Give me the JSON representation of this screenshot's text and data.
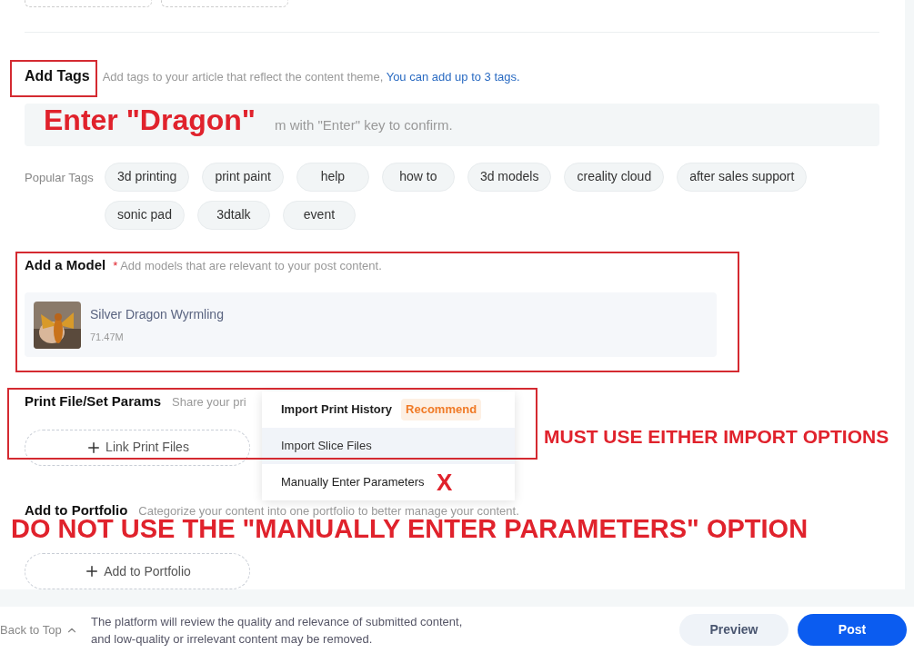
{
  "tags_section": {
    "title": "Add Tags",
    "hint": "Add tags to your article that reflect the content theme,",
    "limit_link": "You can add up to 3 tags.",
    "field": {
      "placeholder": "m with \"Enter\" key to confirm."
    },
    "popular_label": "Popular Tags",
    "popular_tags": [
      "3d printing",
      "print paint",
      "help",
      "how to",
      "3d models",
      "creality cloud",
      "after sales support",
      "sonic pad",
      "3dtalk",
      "event"
    ]
  },
  "model_section": {
    "title": "Add a Model",
    "required_mark": "*",
    "hint": "Add models that are relevant to your post content.",
    "models": [
      {
        "name": "Silver Dragon Wyrmling",
        "size": "71.47M"
      }
    ]
  },
  "print_section": {
    "title": "Print File/Set Params",
    "hint": "Share your pri",
    "button": "Link Print Files",
    "menu": [
      {
        "label": "Import Print History",
        "badge": "Recommend",
        "selected": false
      },
      {
        "label": "Import Slice Files",
        "selected": true
      },
      {
        "label": "Manually Enter Parameters",
        "selected": false
      }
    ]
  },
  "portfolio_section": {
    "title": "Add to Portfolio",
    "hint": "Categorize your content into one portfolio to better manage your content.",
    "button": "Add to Portfolio"
  },
  "footer": {
    "back_to_top": "Back to Top",
    "notice": [
      "The platform will review the quality and relevance of submitted content,",
      "and low-quality or irrelevant content may be removed."
    ],
    "preview": "Preview",
    "post": "Post"
  },
  "annotations": [
    {
      "kind": "box"
    },
    {
      "kind": "box"
    },
    {
      "kind": "box"
    },
    {
      "kind": "text",
      "text": "Enter \"Dragon\""
    },
    {
      "kind": "text",
      "text": "MUST USE EITHER IMPORT OPTIONS"
    },
    {
      "kind": "text",
      "text": "X"
    },
    {
      "kind": "text",
      "text": "DO NOT USE THE \"MANUALLY ENTER PARAMETERS\" OPTION"
    }
  ]
}
